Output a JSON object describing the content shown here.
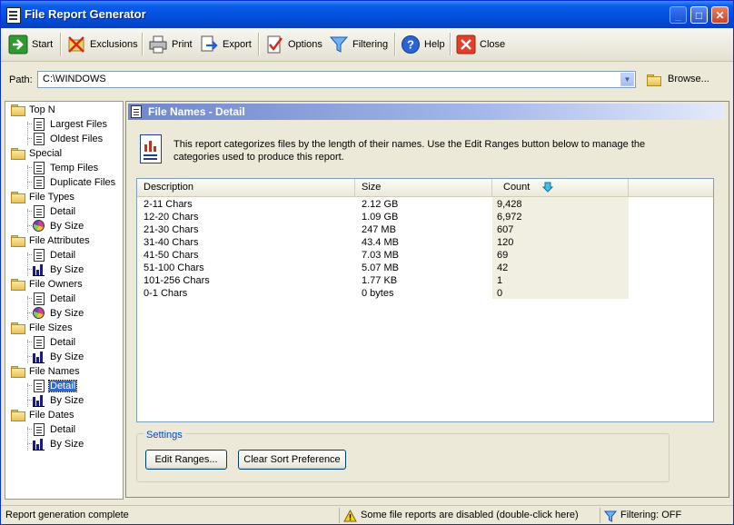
{
  "window": {
    "title": "File Report Generator"
  },
  "toolbar": {
    "start": "Start",
    "exclusions": "Exclusions",
    "print": "Print",
    "export": "Export",
    "options": "Options",
    "filtering": "Filtering",
    "help": "Help",
    "close": "Close"
  },
  "path": {
    "label": "Path:",
    "value": "C:\\WINDOWS",
    "browse": "Browse..."
  },
  "tree": {
    "top_n": "Top N",
    "largest_files": "Largest Files",
    "oldest_files": "Oldest Files",
    "special": "Special",
    "temp_files": "Temp Files",
    "duplicate_files": "Duplicate Files",
    "file_types": "File Types",
    "file_attributes": "File Attributes",
    "file_owners": "File Owners",
    "file_sizes": "File Sizes",
    "file_names": "File Names",
    "file_dates": "File Dates",
    "detail": "Detail",
    "by_size": "By Size"
  },
  "panel": {
    "title": "File Names - Detail",
    "description": "This report categorizes files by the length of their names. Use the Edit Ranges button below to manage the categories used to produce this report."
  },
  "table": {
    "headers": [
      "Description",
      "Size",
      "Count"
    ],
    "rows": [
      [
        "2-11 Chars",
        "2.12 GB",
        "9,428"
      ],
      [
        "12-20 Chars",
        "1.09 GB",
        "6,972"
      ],
      [
        "21-30 Chars",
        "247 MB",
        "607"
      ],
      [
        "31-40 Chars",
        "43.4 MB",
        "120"
      ],
      [
        "41-50 Chars",
        "7.03 MB",
        "69"
      ],
      [
        "51-100 Chars",
        "5.07 MB",
        "42"
      ],
      [
        "101-256 Chars",
        "1.77 KB",
        "1"
      ],
      [
        "0-1 Chars",
        "0 bytes",
        "0"
      ]
    ]
  },
  "settings": {
    "legend": "Settings",
    "edit_ranges": "Edit Ranges...",
    "clear_sort": "Clear Sort Preference"
  },
  "status": {
    "message": "Report generation complete",
    "disabled_notice": "Some file reports are disabled (double-click here)",
    "filtering": "Filtering: OFF"
  },
  "colors": {
    "title_bar": "#0453e0",
    "selection": "#316ac5",
    "panel_header": "#6f86cb",
    "accent_link": "#0046d5"
  }
}
